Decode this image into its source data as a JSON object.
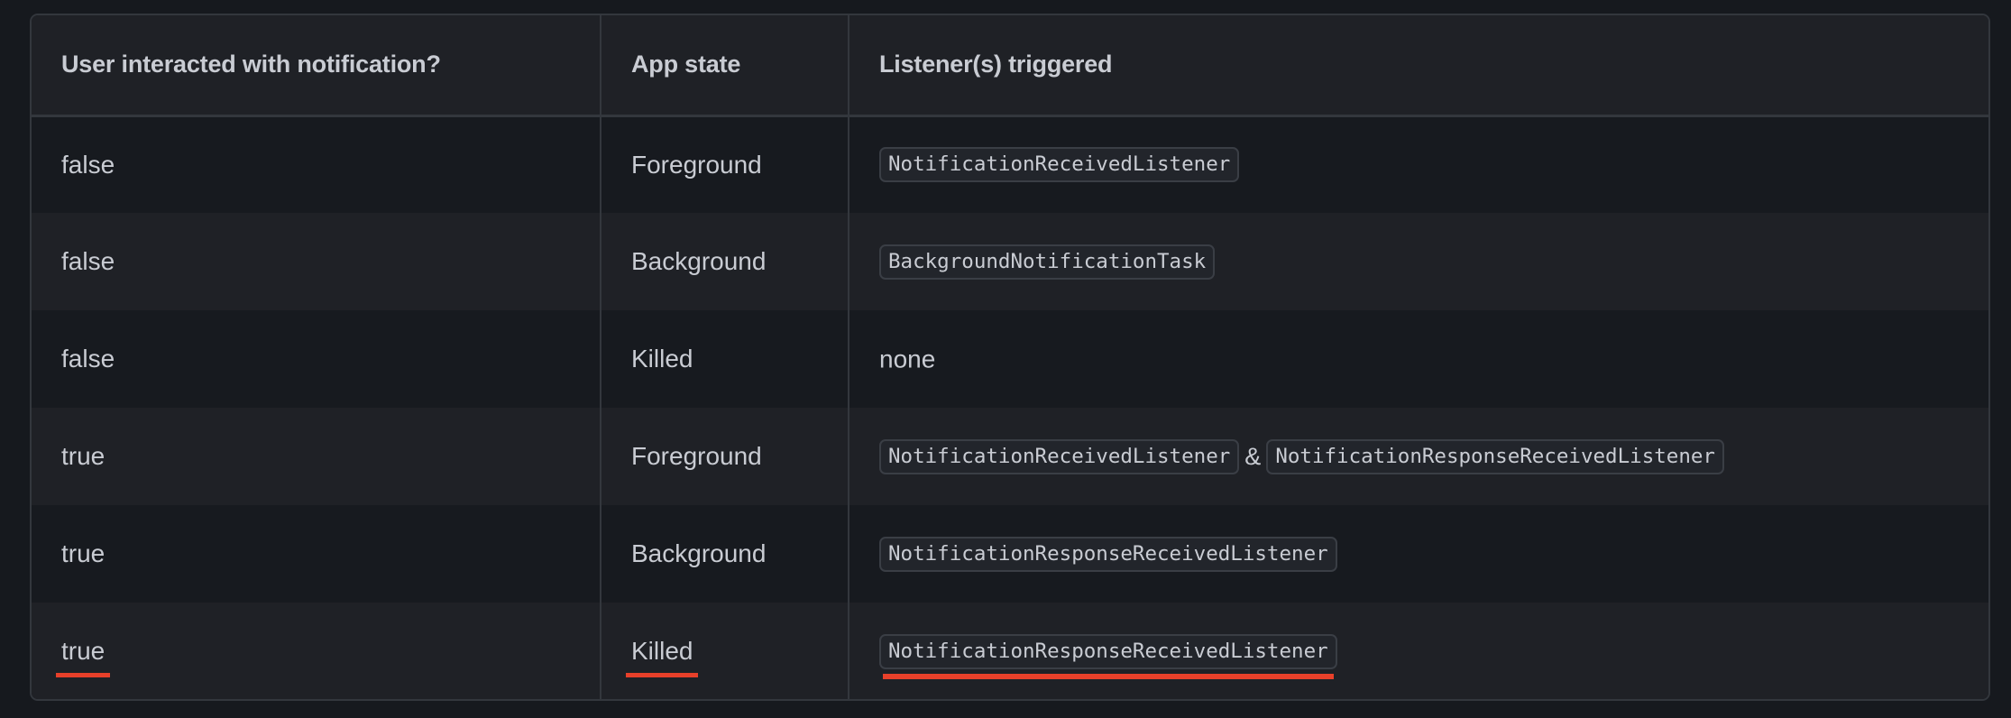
{
  "table": {
    "headers": [
      "User interacted with notification?",
      "App state",
      "Listener(s) triggered"
    ],
    "rows": [
      {
        "interacted": "false",
        "app_state": "Foreground",
        "listeners": [
          "NotificationReceivedListener"
        ],
        "separator": "",
        "highlighted": false
      },
      {
        "interacted": "false",
        "app_state": "Background",
        "listeners": [
          "BackgroundNotificationTask"
        ],
        "separator": "",
        "highlighted": false
      },
      {
        "interacted": "false",
        "app_state": "Killed",
        "listeners_text": "none",
        "highlighted": false
      },
      {
        "interacted": "true",
        "app_state": "Foreground",
        "listeners": [
          "NotificationReceivedListener",
          "NotificationResponseReceivedListener"
        ],
        "separator": "&",
        "highlighted": false
      },
      {
        "interacted": "true",
        "app_state": "Background",
        "listeners": [
          "NotificationResponseReceivedListener"
        ],
        "separator": "",
        "highlighted": false
      },
      {
        "interacted": "true",
        "app_state": "Killed",
        "listeners": [
          "NotificationResponseReceivedListener"
        ],
        "separator": "",
        "highlighted": true
      }
    ]
  },
  "colors": {
    "page_background": "#16191e",
    "row_dark": "#171a1f",
    "row_light": "#1f2126",
    "border": "#33373d",
    "text": "#c9ccd3",
    "highlight_underline": "#e8402a"
  }
}
